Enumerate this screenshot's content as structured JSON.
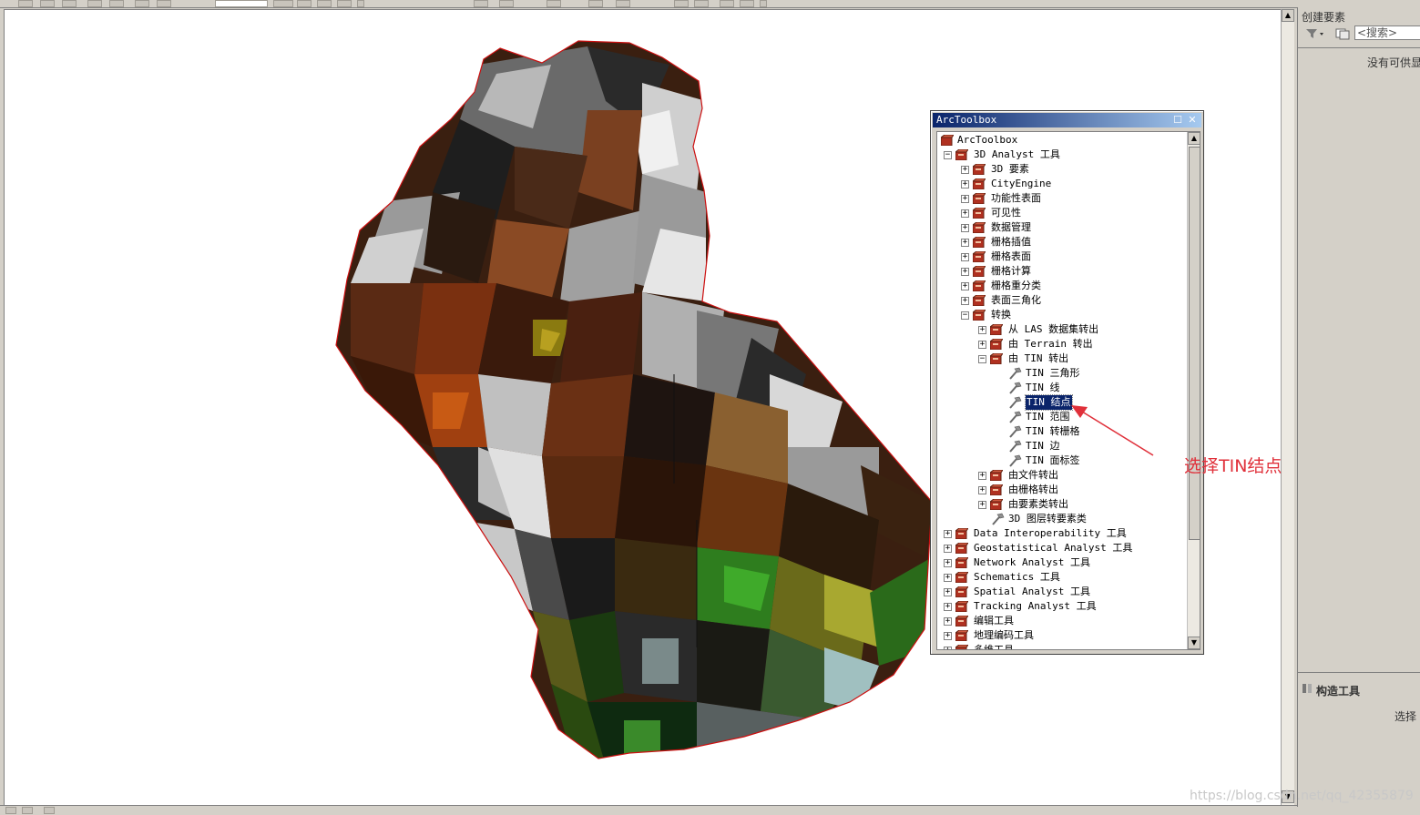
{
  "toolbar": {},
  "map": {},
  "toolbox": {
    "title": "ArcToolbox",
    "root": "ArcToolbox",
    "items": [
      {
        "label": "3D Analyst 工具",
        "exp": "−",
        "icon": "box",
        "indent": 0
      },
      {
        "label": "3D 要素",
        "exp": "+",
        "icon": "box",
        "indent": 1
      },
      {
        "label": "CityEngine",
        "exp": "+",
        "icon": "box",
        "indent": 1
      },
      {
        "label": "功能性表面",
        "exp": "+",
        "icon": "box",
        "indent": 1
      },
      {
        "label": "可见性",
        "exp": "+",
        "icon": "box",
        "indent": 1
      },
      {
        "label": "数据管理",
        "exp": "+",
        "icon": "box",
        "indent": 1
      },
      {
        "label": "栅格插值",
        "exp": "+",
        "icon": "box",
        "indent": 1
      },
      {
        "label": "栅格表面",
        "exp": "+",
        "icon": "box",
        "indent": 1
      },
      {
        "label": "栅格计算",
        "exp": "+",
        "icon": "box",
        "indent": 1
      },
      {
        "label": "栅格重分类",
        "exp": "+",
        "icon": "box",
        "indent": 1
      },
      {
        "label": "表面三角化",
        "exp": "+",
        "icon": "box",
        "indent": 1
      },
      {
        "label": "转换",
        "exp": "−",
        "icon": "box",
        "indent": 1
      },
      {
        "label": "从 LAS 数据集转出",
        "exp": "+",
        "icon": "box",
        "indent": 2
      },
      {
        "label": "由 Terrain 转出",
        "exp": "+",
        "icon": "box",
        "indent": 2
      },
      {
        "label": "由 TIN 转出",
        "exp": "−",
        "icon": "box",
        "indent": 2
      },
      {
        "label": "TIN 三角形",
        "exp": "",
        "icon": "tool",
        "indent": 3
      },
      {
        "label": "TIN 线",
        "exp": "",
        "icon": "tool",
        "indent": 3
      },
      {
        "label": "TIN 结点",
        "exp": "",
        "icon": "tool",
        "indent": 3,
        "selected": true
      },
      {
        "label": "TIN 范围",
        "exp": "",
        "icon": "tool",
        "indent": 3
      },
      {
        "label": "TIN 转栅格",
        "exp": "",
        "icon": "tool",
        "indent": 3
      },
      {
        "label": "TIN 边",
        "exp": "",
        "icon": "tool",
        "indent": 3
      },
      {
        "label": "TIN 面标签",
        "exp": "",
        "icon": "tool",
        "indent": 3
      },
      {
        "label": "由文件转出",
        "exp": "+",
        "icon": "box",
        "indent": 2
      },
      {
        "label": "由栅格转出",
        "exp": "+",
        "icon": "box",
        "indent": 2
      },
      {
        "label": "由要素类转出",
        "exp": "+",
        "icon": "box",
        "indent": 2
      },
      {
        "label": "3D 图层转要素类",
        "exp": "",
        "icon": "tool",
        "indent": 2
      },
      {
        "label": "Data Interoperability 工具",
        "exp": "+",
        "icon": "box",
        "indent": 0
      },
      {
        "label": "Geostatistical Analyst 工具",
        "exp": "+",
        "icon": "box",
        "indent": 0
      },
      {
        "label": "Network Analyst 工具",
        "exp": "+",
        "icon": "box",
        "indent": 0
      },
      {
        "label": "Schematics 工具",
        "exp": "+",
        "icon": "box",
        "indent": 0
      },
      {
        "label": "Spatial Analyst 工具",
        "exp": "+",
        "icon": "box",
        "indent": 0
      },
      {
        "label": "Tracking Analyst 工具",
        "exp": "+",
        "icon": "box",
        "indent": 0
      },
      {
        "label": "编辑工具",
        "exp": "+",
        "icon": "box",
        "indent": 0
      },
      {
        "label": "地理编码工具",
        "exp": "+",
        "icon": "box",
        "indent": 0
      },
      {
        "label": "多维工具",
        "exp": "+",
        "icon": "box",
        "indent": 0
      }
    ]
  },
  "right_panel": {
    "title": "创建要素",
    "search_placeholder": "<搜索>",
    "empty_note": "没有可供显",
    "construct_title": "构造工具",
    "construct_note": "选择"
  },
  "annotation": {
    "callout": "选择TIN结点",
    "watermark": "https://blog.csdn.net/qq_42355879",
    "color": "#e0303a"
  },
  "colors": {
    "title_bar": "#0a246a",
    "selection": "#0a246a",
    "tin_brown": "#5a2a12",
    "tin_gray": "#a8a8a8",
    "tin_green": "#2e7d1e"
  }
}
